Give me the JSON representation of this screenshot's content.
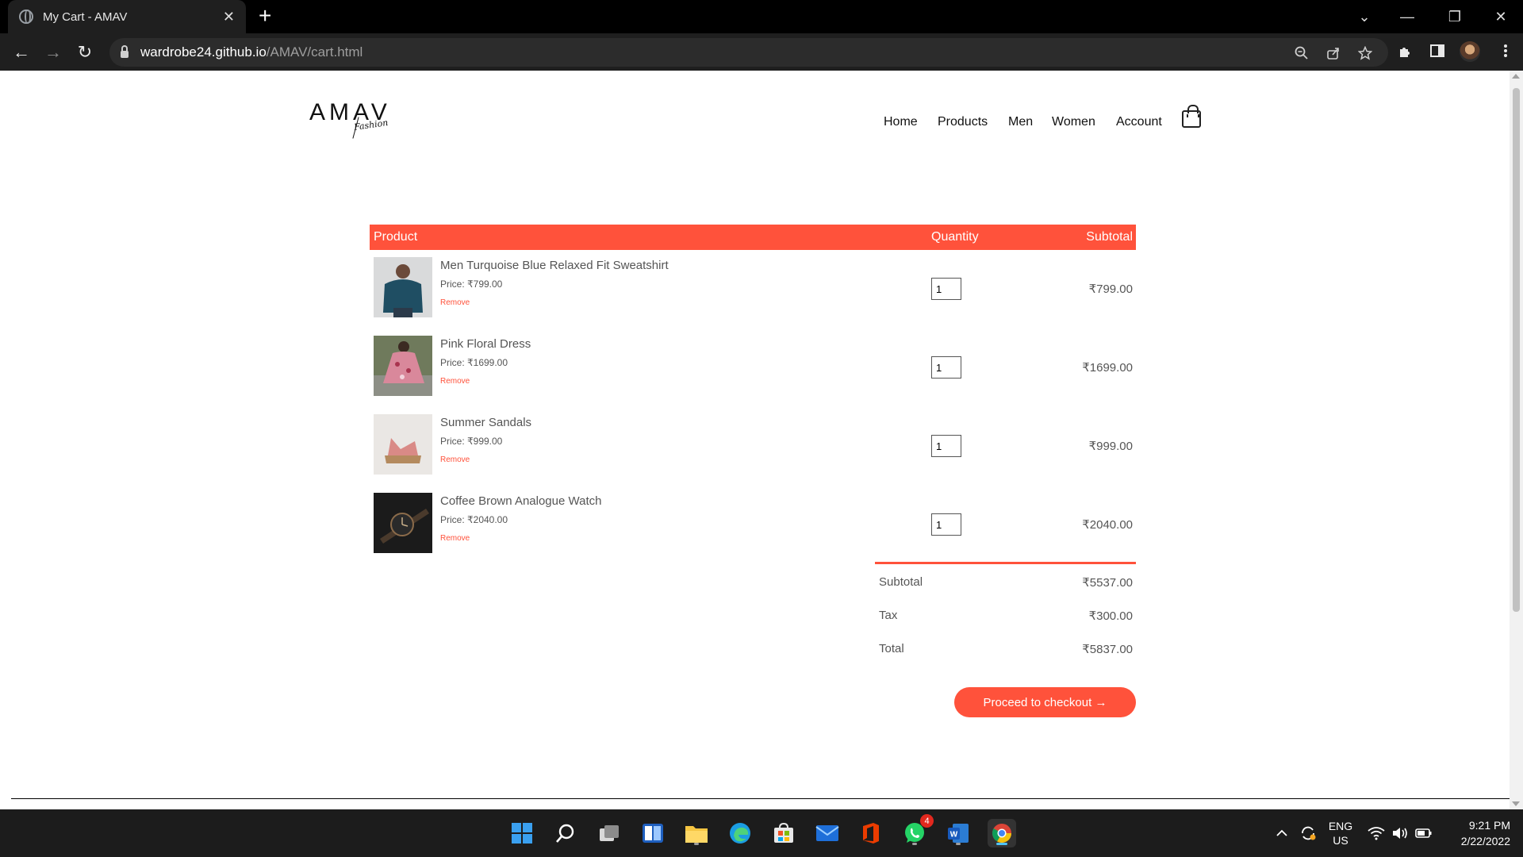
{
  "browser": {
    "tab_title": "My Cart - AMAV",
    "tab_close": "✕",
    "new_tab": "+",
    "url_host": "wardrobe24.github.io",
    "url_path": "/AMAV/cart.html",
    "window_controls": [
      "⌄",
      "—",
      "❐",
      "✕"
    ],
    "nav": {
      "back": "←",
      "forward": "→",
      "reload": "↻"
    }
  },
  "site": {
    "logo_word": "AMAV",
    "logo_script": "Fashion",
    "nav": [
      "Home",
      "Products",
      "Men",
      "Women",
      "Account"
    ]
  },
  "cart": {
    "headers": {
      "product": "Product",
      "quantity": "Quantity",
      "subtotal": "Subtotal"
    },
    "items": [
      {
        "name": "Men Turquoise Blue Relaxed Fit Sweatshirt",
        "price": "Price: ₹799.00",
        "remove": "Remove",
        "qty": "1",
        "subtotal": "₹799.00"
      },
      {
        "name": "Pink Floral Dress",
        "price": "Price: ₹1699.00",
        "remove": "Remove",
        "qty": "1",
        "subtotal": "₹1699.00"
      },
      {
        "name": "Summer Sandals",
        "price": "Price: ₹999.00",
        "remove": "Remove",
        "qty": "1",
        "subtotal": "₹999.00"
      },
      {
        "name": "Coffee Brown Analogue Watch",
        "price": "Price: ₹2040.00",
        "remove": "Remove",
        "qty": "1",
        "subtotal": "₹2040.00"
      }
    ],
    "totals": {
      "subtotal_label": "Subtotal",
      "subtotal": "₹5537.00",
      "tax_label": "Tax",
      "tax": "₹300.00",
      "total_label": "Total",
      "total": "₹5837.00"
    },
    "checkout": "Proceed to checkout →"
  },
  "taskbar": {
    "whatsapp_badge": "4",
    "lang_top": "ENG",
    "lang_bottom": "US",
    "time": "9:21 PM",
    "date": "2/22/2022"
  },
  "colors": {
    "accent": "#ff523b",
    "chrome": "#1f1f1f",
    "taskbar": "#1c1c1c"
  }
}
